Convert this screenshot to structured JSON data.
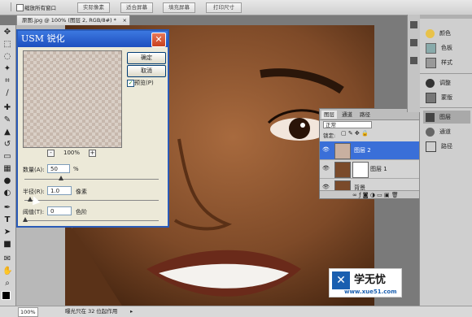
{
  "options_bar": {
    "checkbox_label": "缩放所有窗口",
    "buttons": [
      "实际像素",
      "适合屏幕",
      "填充屏幕",
      "打印尺寸"
    ]
  },
  "document_tab": {
    "title": "原图.jpg @ 100% (图层 2, RGB/8#) *"
  },
  "toolbox": {
    "icons": [
      "move-icon",
      "marquee-icon",
      "lasso-icon",
      "magic-wand-icon",
      "crop-icon",
      "eyedropper-icon",
      "healing-brush-icon",
      "brush-icon",
      "clone-stamp-icon",
      "history-brush-icon",
      "eraser-icon",
      "gradient-icon",
      "blur-icon",
      "dodge-icon",
      "pen-icon",
      "type-icon",
      "path-selection-icon",
      "shape-icon",
      "notes-icon",
      "hand-icon",
      "zoom-icon"
    ]
  },
  "dock": {
    "group1": [
      "颜色",
      "色板",
      "样式"
    ],
    "group2": [
      "调整",
      "蒙版"
    ],
    "group3": [
      "图层",
      "通道",
      "路径"
    ]
  },
  "usm_dialog": {
    "title": "USM 锐化",
    "ok_label": "确定",
    "cancel_label": "取消",
    "preview_label": "预览(P)",
    "zoom_label": "100%",
    "zoom_out": "-",
    "zoom_in": "+",
    "amount_label": "数量(A):",
    "amount_value": "50",
    "amount_unit": "%",
    "radius_label": "半径(R):",
    "radius_value": "1.0",
    "radius_unit": "像素",
    "threshold_label": "阈值(T):",
    "threshold_value": "0",
    "threshold_unit": "色阶"
  },
  "layers_panel": {
    "tabs": [
      "图层",
      "通道",
      "路径"
    ],
    "blend_mode": "正常",
    "lock_label": "锁定:",
    "layers": [
      {
        "name": "图层 2",
        "selected": true
      },
      {
        "name": "图层 1",
        "selected": false
      },
      {
        "name": "背景",
        "selected": false
      }
    ]
  },
  "status_bar": {
    "zoom": "100%",
    "info": "曝光只在 32 位起作用"
  },
  "watermark": {
    "name": "学无忧",
    "url": "www.xue51.com"
  },
  "colors": {
    "dialog_title": "#2a5bb8",
    "selected_layer": "#3a6fd8",
    "close_button": "#d45a32"
  }
}
